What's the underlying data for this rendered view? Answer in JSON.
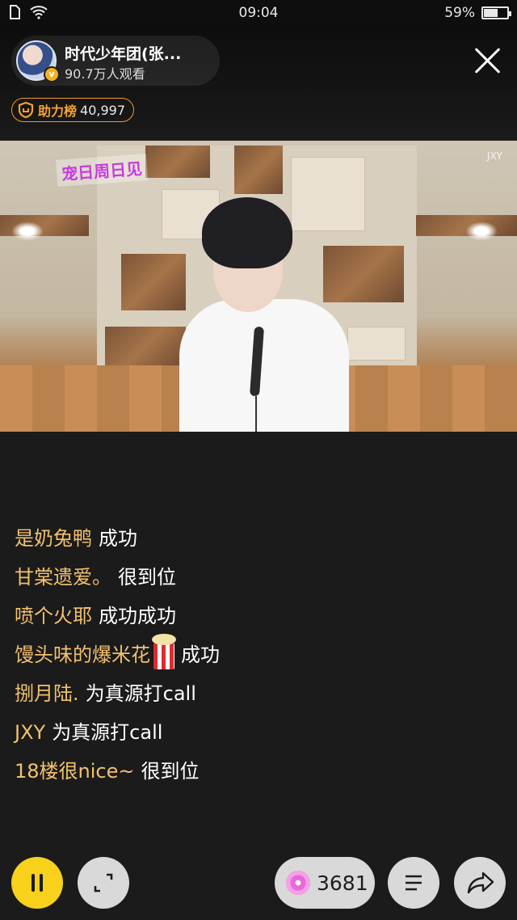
{
  "status_bar": {
    "time": "09:04",
    "battery": "59%",
    "battery_level": 0.59
  },
  "header": {
    "anchor_name": "时代少年团(张...",
    "viewers": "90.7万人观看",
    "support_rank": {
      "label": "助力榜",
      "value": "40,997"
    }
  },
  "video": {
    "logo_text": "宠日周日见",
    "watermark": "JXY"
  },
  "danmaku": [
    {
      "user": "是奶兔鸭",
      "message": "成功"
    },
    {
      "user": "甘棠遗爱。",
      "message": "很到位"
    },
    {
      "user": "喷个火耶",
      "message": "成功成功"
    },
    {
      "user": "馒头味的爆米花",
      "message": "成功",
      "emoji": "popcorn"
    },
    {
      "user": "捌月陆.",
      "message": "为真源打call"
    },
    {
      "user": "JXY",
      "message": "为真源打call"
    },
    {
      "user": "18楼很nice~",
      "message": "很到位"
    }
  ],
  "controls": {
    "gift_count": "3681"
  },
  "colors": {
    "accent_yellow": "#f7d11c",
    "username_gold": "#f2c16e",
    "rank_orange": "#f09a2e"
  },
  "icons": [
    "sim-icon",
    "wifi-icon",
    "battery-icon",
    "close-icon",
    "shield-icon",
    "pause-icon",
    "expand-icon",
    "candy-icon",
    "menu-icon",
    "share-icon"
  ]
}
